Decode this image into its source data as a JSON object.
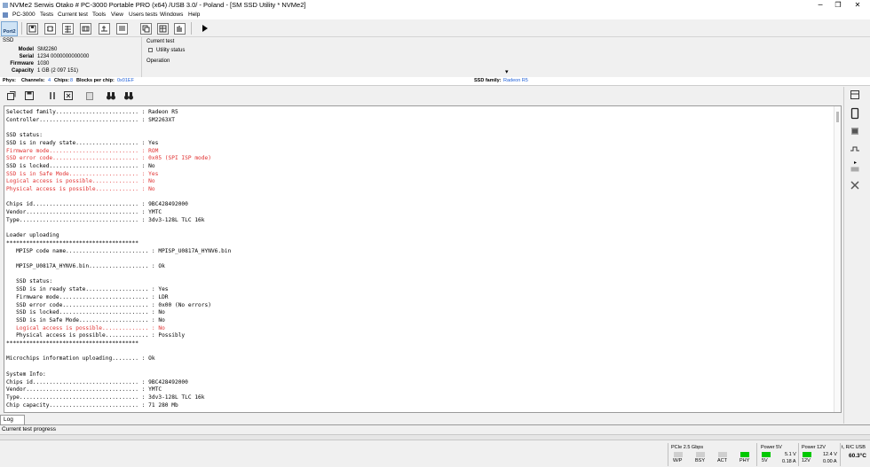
{
  "window": {
    "title": "NVMe2     Serwis Otako    # PC-3000 Portable PRO (x64) /USB 3.0/ - Poland - [SM SSD Utility * NVMe2]",
    "minimize_glyph": "─",
    "maximize_glyph": "❐",
    "close_glyph": "✕"
  },
  "menu": [
    "PC-3000",
    "Tests",
    "Current test",
    "Tools",
    "View",
    "Users tests",
    "Windows",
    "Help"
  ],
  "toolbar": {
    "port_label": "Port2"
  },
  "info": {
    "header": "SSD",
    "fields": [
      {
        "label": "Model",
        "value": "SM2260"
      },
      {
        "label": "Serial",
        "value": "1234    0000000000000"
      },
      {
        "label": "Firmware",
        "value": "1030"
      },
      {
        "label": "Capacity",
        "value": "1 GB (2 097 151)"
      }
    ]
  },
  "current_test": {
    "header": "Current test",
    "value": "Utility status",
    "operation_label": "Operation",
    "arrow": "▾"
  },
  "phys": {
    "phys_label": "Phys:",
    "channels_label": "Channels:",
    "channels_value": "4",
    "chips_label": "Chips:",
    "chips_value": "8",
    "blocks_label": "Blocks per chip:",
    "blocks_value": "0x01EF",
    "family_label": "SSD family:",
    "family_value": "Radeon R5"
  },
  "log": {
    "lines": [
      {
        "text": "Selected family......................... : Radeon R5",
        "color": "black"
      },
      {
        "text": "Controller.............................. : SM2263XT",
        "color": "black"
      },
      {
        "text": "",
        "color": "black"
      },
      {
        "text": "SSD status:",
        "color": "black"
      },
      {
        "text": "SSD is in ready state................... : Yes",
        "color": "black"
      },
      {
        "text": "Firmware mode........................... : ROM",
        "color": "red"
      },
      {
        "text": "SSD error code.......................... : 0x05 (SPI ISP mode)",
        "color": "red"
      },
      {
        "text": "SSD is locked........................... : No",
        "color": "black"
      },
      {
        "text": "SSD is in Safe Mode..................... : Yes",
        "color": "red"
      },
      {
        "text": "Logical access is possible.............. : No",
        "color": "red"
      },
      {
        "text": "Physical access is possible............. : No",
        "color": "red"
      },
      {
        "text": "",
        "color": "black"
      },
      {
        "text": "Chips id................................ : 9BC428492000",
        "color": "black"
      },
      {
        "text": "Vendor.................................. : YMTC",
        "color": "black"
      },
      {
        "text": "Type.................................... : 3dv3-128L TLC 16k",
        "color": "black"
      },
      {
        "text": "",
        "color": "black"
      },
      {
        "text": "Loader uploading",
        "color": "black"
      },
      {
        "text": "****************************************",
        "color": "black"
      },
      {
        "text": "   MPISP code name......................... : MPISP_U0817A_HYNV6.bin",
        "color": "black"
      },
      {
        "text": "",
        "color": "black"
      },
      {
        "text": "   MPISP_U0817A_HYNV6.bin.................. : Ok",
        "color": "black"
      },
      {
        "text": "",
        "color": "black"
      },
      {
        "text": "   SSD status:",
        "color": "black"
      },
      {
        "text": "   SSD is in ready state................... : Yes",
        "color": "black"
      },
      {
        "text": "   Firmware mode........................... : LDR",
        "color": "black"
      },
      {
        "text": "   SSD error code.......................... : 0x00 (No errors)",
        "color": "black"
      },
      {
        "text": "   SSD is locked........................... : No",
        "color": "black"
      },
      {
        "text": "   SSD is in Safe Mode..................... : No",
        "color": "black"
      },
      {
        "text": "   Logical access is possible.............. : No",
        "color": "red"
      },
      {
        "text": "   Physical access is possible............. : Possibly",
        "color": "black"
      },
      {
        "text": "****************************************",
        "color": "black"
      },
      {
        "text": "",
        "color": "black"
      },
      {
        "text": "Microchips information uploading........ : Ok",
        "color": "black"
      },
      {
        "text": "",
        "color": "black"
      },
      {
        "text": "System Info:",
        "color": "black"
      },
      {
        "text": "Chips id................................ : 9BC428492000",
        "color": "black"
      },
      {
        "text": "Vendor.................................. : YMTC",
        "color": "black"
      },
      {
        "text": "Type.................................... : 3dv3-128L TLC 16k",
        "color": "black"
      },
      {
        "text": "Chip capacity........................... : 71 280 Mb",
        "color": "black"
      }
    ]
  },
  "tabs": {
    "log": "Log"
  },
  "progress": {
    "label": "Current test progress",
    "fraction": 0
  },
  "status": {
    "pcie": "PCIe 2.5 Gbps",
    "leds": [
      {
        "label": "W/P",
        "on": false
      },
      {
        "label": "BSY",
        "on": false
      },
      {
        "label": "ACT",
        "on": false
      },
      {
        "label": "PHY",
        "on": true
      }
    ],
    "power5v": {
      "title": "Power 5V",
      "led": "5V",
      "volts": "5.1 V",
      "amps": "0.18 A"
    },
    "power12v": {
      "title": "Power 12V",
      "led": "12V",
      "volts": "12.4 V",
      "amps": "0.00 A"
    },
    "temp": {
      "title": "t, R/C USB",
      "value": "60.3°C"
    }
  },
  "colors": {
    "red": "#e03030",
    "blue": "#1e5fd8",
    "led_green": "#00c800",
    "progress_green": "#06b025"
  }
}
